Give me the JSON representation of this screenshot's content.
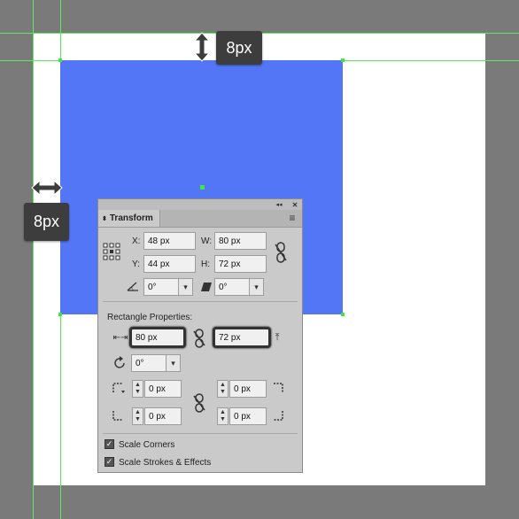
{
  "measurements": {
    "top_gap": "8px",
    "left_gap": "8px"
  },
  "panel": {
    "title": "Transform",
    "collapse_glyph": "◂◂",
    "close_glyph": "✕",
    "menu_glyph": "≡",
    "x_label": "X:",
    "x_value": "48 px",
    "y_label": "Y:",
    "y_value": "44 px",
    "w_label": "W:",
    "w_value": "80 px",
    "h_label": "H:",
    "h_value": "72 px",
    "angle_value": "0°",
    "shear_value": "0°",
    "rect_props_label": "Rectangle Properties:",
    "rect_width": "80 px",
    "rect_height": "72 px",
    "rect_angle": "0°",
    "corner_tl": "0 px",
    "corner_tr": "0 px",
    "corner_bl": "0 px",
    "corner_br": "0 px",
    "scale_corners_label": "Scale Corners",
    "scale_corners_checked": true,
    "scale_strokes_label": "Scale Strokes & Effects",
    "scale_strokes_checked": true
  }
}
